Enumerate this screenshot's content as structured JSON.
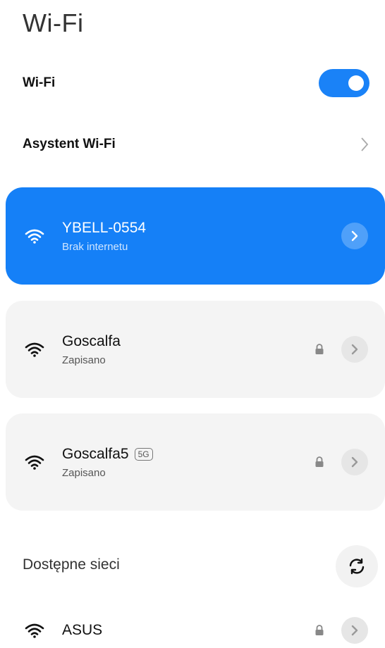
{
  "header": {
    "title": "Wi-Fi"
  },
  "wifi_toggle": {
    "label": "Wi-Fi",
    "enabled": true
  },
  "assistant": {
    "label": "Asystent Wi-Fi"
  },
  "connected_network": {
    "name": "YBELL-0554",
    "status": "Brak internetu"
  },
  "saved_networks": [
    {
      "name": "Goscalfa",
      "status": "Zapisano",
      "badge": ""
    },
    {
      "name": "Goscalfa5",
      "status": "Zapisano",
      "badge": "5G"
    }
  ],
  "available": {
    "label": "Dostępne sieci",
    "networks": [
      {
        "name": "ASUS"
      }
    ]
  },
  "colors": {
    "accent": "#1580f7",
    "card_bg": "#f4f4f4"
  },
  "icons": [
    "wifi-icon",
    "lock-icon",
    "chevron-right-icon",
    "refresh-icon"
  ]
}
